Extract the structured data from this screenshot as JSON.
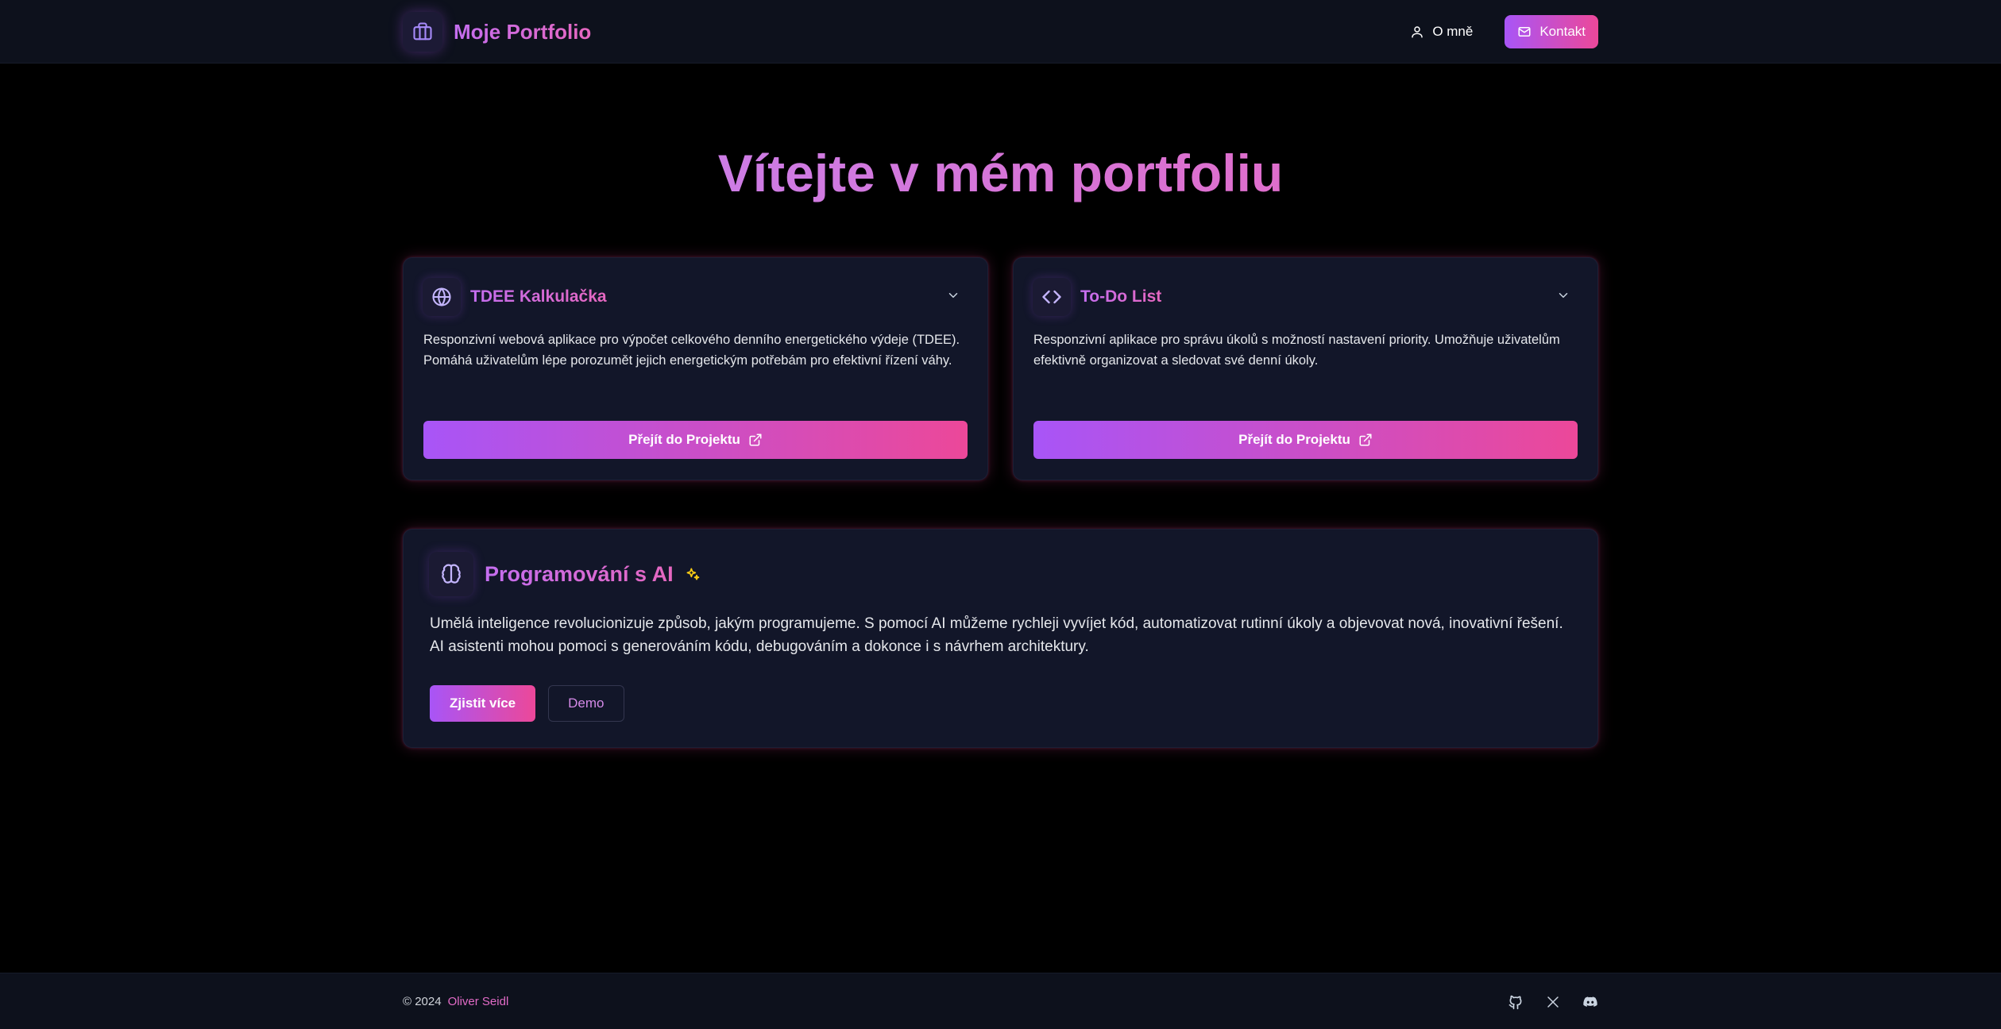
{
  "header": {
    "brand_title": "Moje Portfolio",
    "brand_icon": "briefcase-icon",
    "about_label": "O mně",
    "about_icon": "user-icon",
    "contact_label": "Kontakt",
    "contact_icon": "mail-icon"
  },
  "hero": {
    "title": "Vítejte v mém portfoliu"
  },
  "projects": [
    {
      "icon": "globe-icon",
      "title": "TDEE Kalkulačka",
      "description": "Responzivní webová aplikace pro výpočet celkového denního energetického výdeje (TDEE). Pomáhá uživatelům lépe porozumět jejich energetickým potřebám pro efektivní řízení váhy.",
      "button_label": "Přejít do Projektu"
    },
    {
      "icon": "code-icon",
      "title": "To-Do List",
      "description": "Responzivní aplikace pro správu úkolů s možností nastavení priority. Umožňuje uživatelům efektivně organizovat a sledovat své denní úkoly.",
      "button_label": "Přejít do Projektu"
    }
  ],
  "ai_section": {
    "icon": "brain-icon",
    "title": "Programování s AI",
    "sparkle_icon": "sparkles-icon",
    "description": "Umělá inteligence revolucionizuje způsob, jakým programujeme. S pomocí AI můžeme rychleji vyvíjet kód, automatizovat rutinní úkoly a objevovat nová, inovativní řešení. AI asistenti mohou pomoci s generováním kódu, debugováním a dokonce i s návrhem architektury.",
    "primary_button": "Zjistit více",
    "secondary_button": "Demo"
  },
  "footer": {
    "copyright": "© 2024",
    "author": "Oliver Seidl",
    "socials": [
      "github-icon",
      "x-icon",
      "discord-icon"
    ]
  },
  "colors": {
    "accent_purple": "#a855f7",
    "accent_pink": "#ec4899",
    "background": "#000000",
    "card_background": "#121629"
  }
}
